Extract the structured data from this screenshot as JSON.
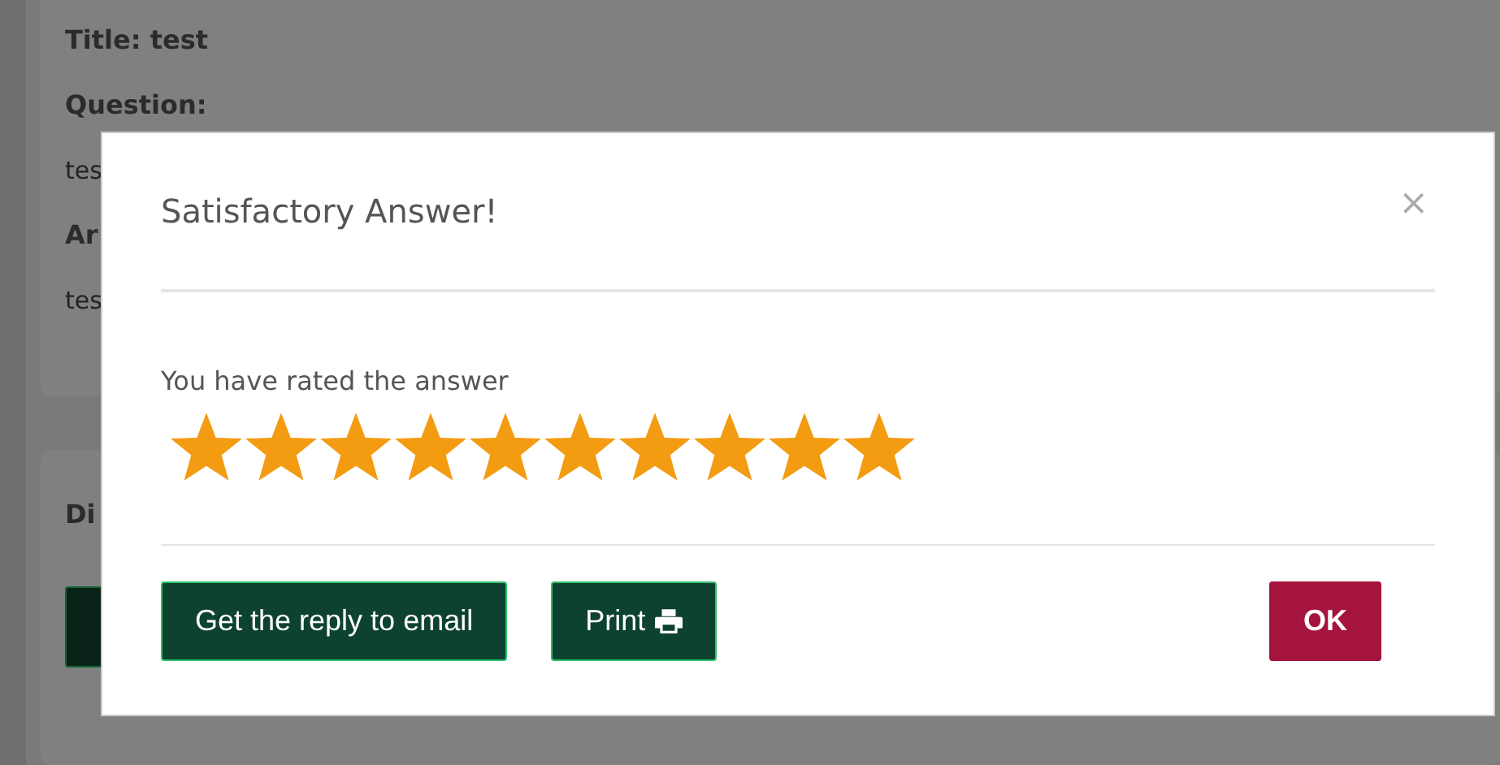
{
  "page": {
    "details_card": {
      "title": "Title: test",
      "question_label": "Question:",
      "question_text": "tes",
      "answer_label": "Ar",
      "answer_text": "tes"
    },
    "second_card": {
      "heading": "Di"
    }
  },
  "modal": {
    "title": "Satisfactory Answer!",
    "close": "×",
    "message": "You have rated the answer",
    "rating": {
      "stars": 10
    },
    "buttons": [
      {
        "kind": "primary",
        "label": "Get the reply to email"
      },
      {
        "kind": "print",
        "label": "Print"
      },
      {
        "kind": "danger",
        "label": "OK"
      }
    ]
  }
}
